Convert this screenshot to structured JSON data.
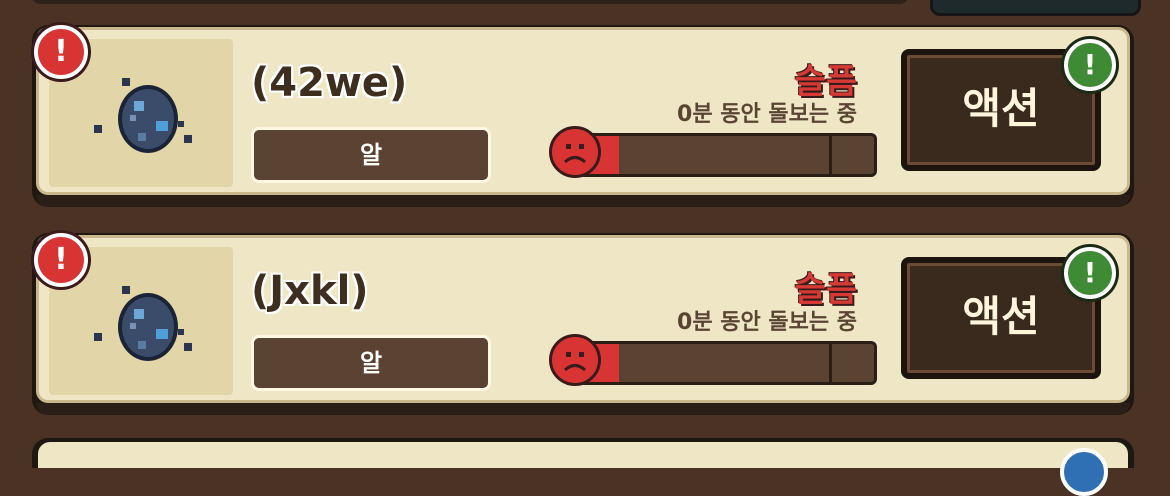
{
  "pets": [
    {
      "name": "(42we)",
      "type": "알",
      "mood": "슬픔",
      "care_status": "0분 동안 돌보는 중",
      "mood_fill": 0.15,
      "action_label": "액션",
      "warn_icon": "!",
      "ok_icon": "!"
    },
    {
      "name": "(Jxkl)",
      "type": "알",
      "mood": "슬픔",
      "care_status": "0분 동안 돌보는 중",
      "mood_fill": 0.15,
      "action_label": "액션",
      "warn_icon": "!",
      "ok_icon": "!"
    }
  ],
  "colors": {
    "mood_sad": "#d53a35",
    "alert": "#d83434",
    "ready": "#3f8a34",
    "panel": "#efe6c6"
  }
}
